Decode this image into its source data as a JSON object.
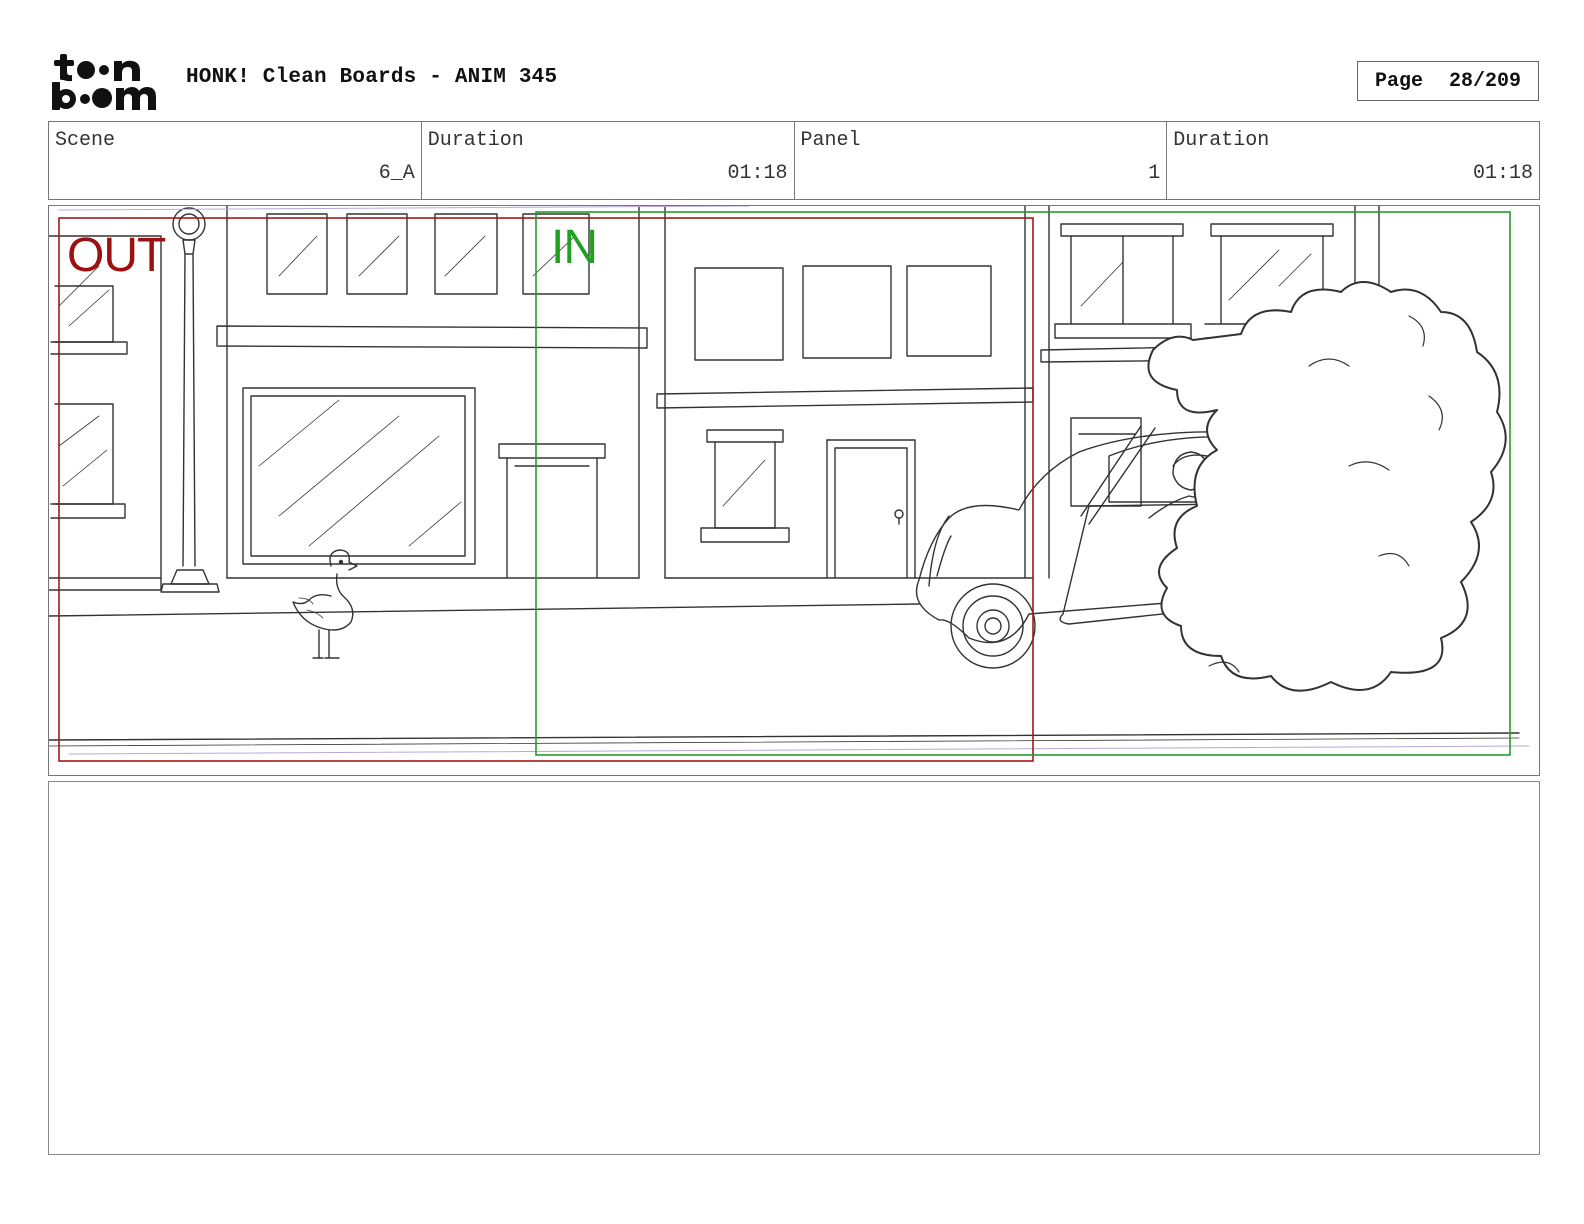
{
  "logo": {
    "line1": "toon",
    "line2": "boom"
  },
  "header": {
    "title": "HONK! Clean Boards - ANIM 345"
  },
  "page": {
    "label": "Page",
    "value": "28/209"
  },
  "info": [
    {
      "label": "Scene",
      "value": "6_A"
    },
    {
      "label": "Duration",
      "value": "01:18"
    },
    {
      "label": "Panel",
      "value": "1"
    },
    {
      "label": "Duration",
      "value": "01:18"
    }
  ],
  "panel": {
    "out_label": "OUT",
    "in_label": "IN"
  },
  "notes": {
    "text": ""
  },
  "colors": {
    "out_frame": "#a11818",
    "in_frame": "#2a9a2a",
    "line": "#333333"
  }
}
